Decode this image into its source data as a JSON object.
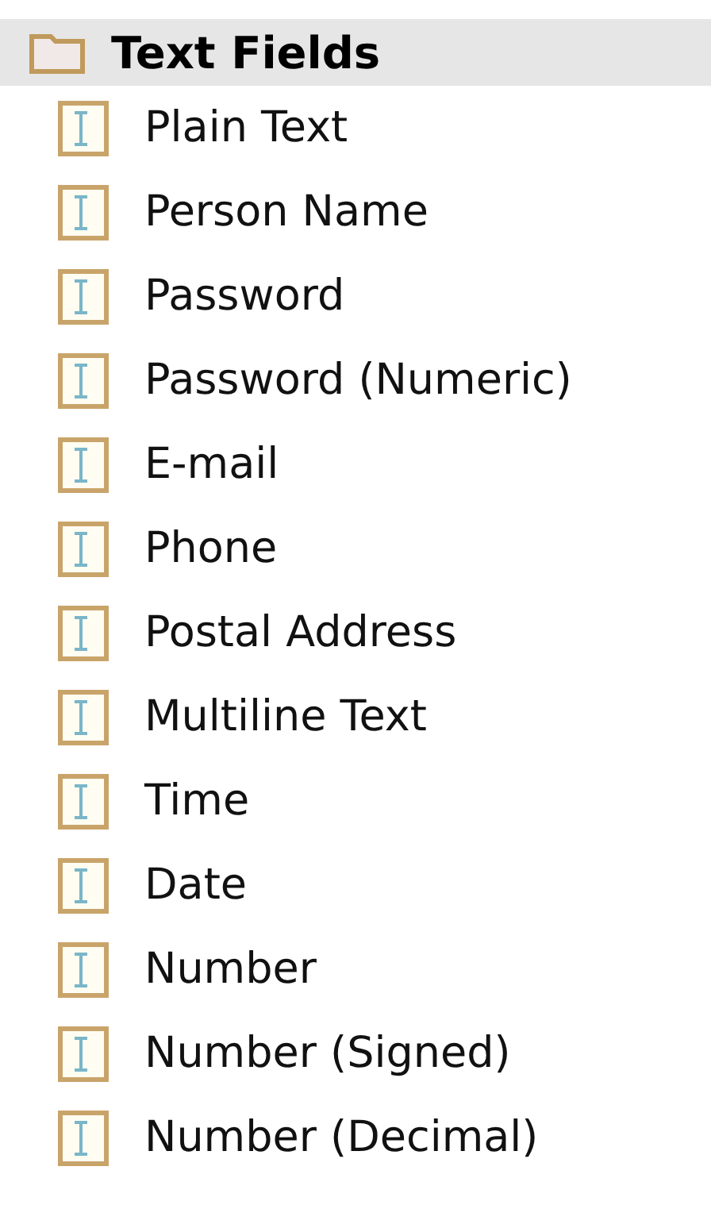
{
  "group": {
    "title": "Text Fields",
    "items": [
      {
        "label": "Plain Text"
      },
      {
        "label": "Person Name"
      },
      {
        "label": "Password"
      },
      {
        "label": "Password (Numeric)"
      },
      {
        "label": "E-mail"
      },
      {
        "label": "Phone"
      },
      {
        "label": "Postal Address"
      },
      {
        "label": "Multiline Text"
      },
      {
        "label": "Time"
      },
      {
        "label": "Date"
      },
      {
        "label": "Number"
      },
      {
        "label": "Number (Signed)"
      },
      {
        "label": "Number (Decimal)"
      }
    ]
  }
}
